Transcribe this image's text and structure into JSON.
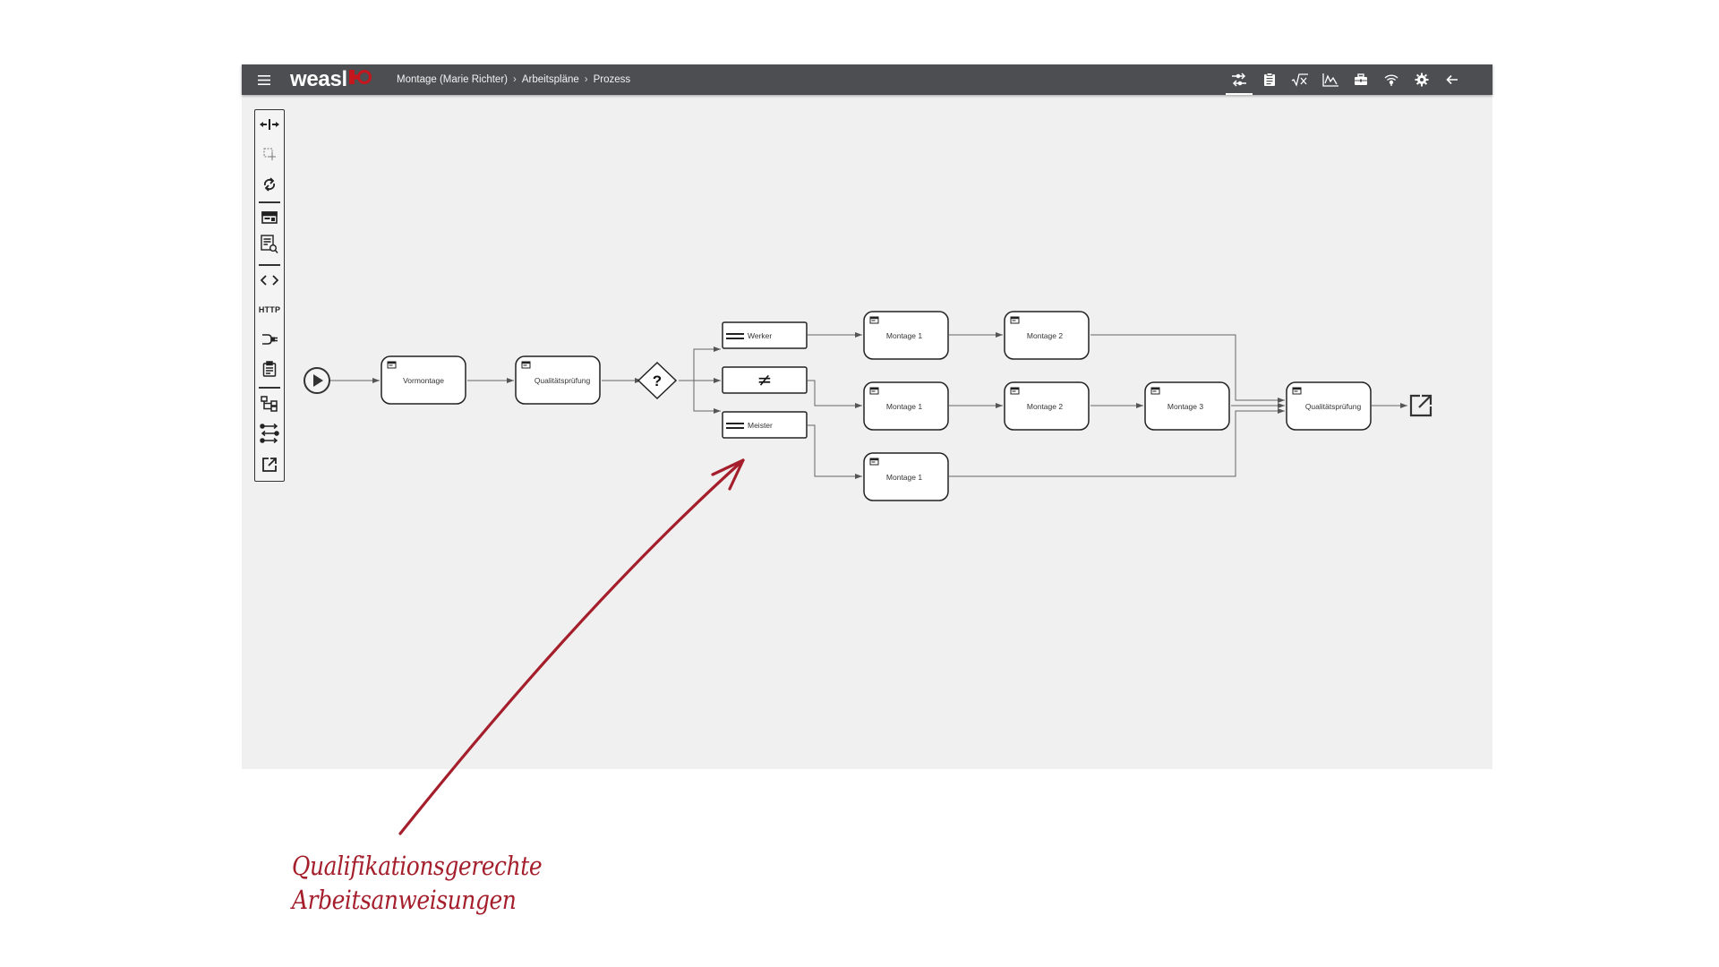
{
  "app": {
    "logo_text": "weasl",
    "brand_color": "#c4161c",
    "topbar_color": "#4d4e52"
  },
  "breadcrumb": {
    "items": [
      "Montage (Marie Richter)",
      "Arbeitspläne",
      "Prozess"
    ],
    "separator": "›"
  },
  "toolbar_icons": [
    "process-flow-icon",
    "clipboard-icon",
    "formula-icon",
    "chart-icon",
    "toolbox-icon",
    "wireless-icon",
    "gear-icon",
    "back-arrow-icon"
  ],
  "palette": {
    "items": [
      "move-icon",
      "select-icon",
      "refresh-icon",
      "screen-icon",
      "document-search-icon",
      "code-icon",
      "http-icon",
      "plug-icon",
      "clipboard-icon",
      "hierarchy-icon",
      "flow-icon",
      "external-link-icon"
    ],
    "http_label": "HTTP"
  },
  "process": {
    "start_node": "start-icon",
    "end_node": "external-link-icon",
    "nodes": {
      "vormontage": "Vormontage",
      "qualitaet1": "Qualitätsprüfung",
      "decision": "?",
      "cond_werker": "Werker",
      "cond_not_equal": "≠",
      "cond_meister": "Meister",
      "r1_montage1": "Montage 1",
      "r1_montage2": "Montage 2",
      "r2_montage1": "Montage 1",
      "r2_montage2": "Montage 2",
      "r2_montage3": "Montage 3",
      "r3_montage1": "Montage 1",
      "qualitaet2": "Qualitätsprüfung"
    }
  },
  "annotation": {
    "line1": "Qualifikationsgerechte",
    "line2": "Arbeitsanweisungen",
    "color": "#a51e2b"
  }
}
